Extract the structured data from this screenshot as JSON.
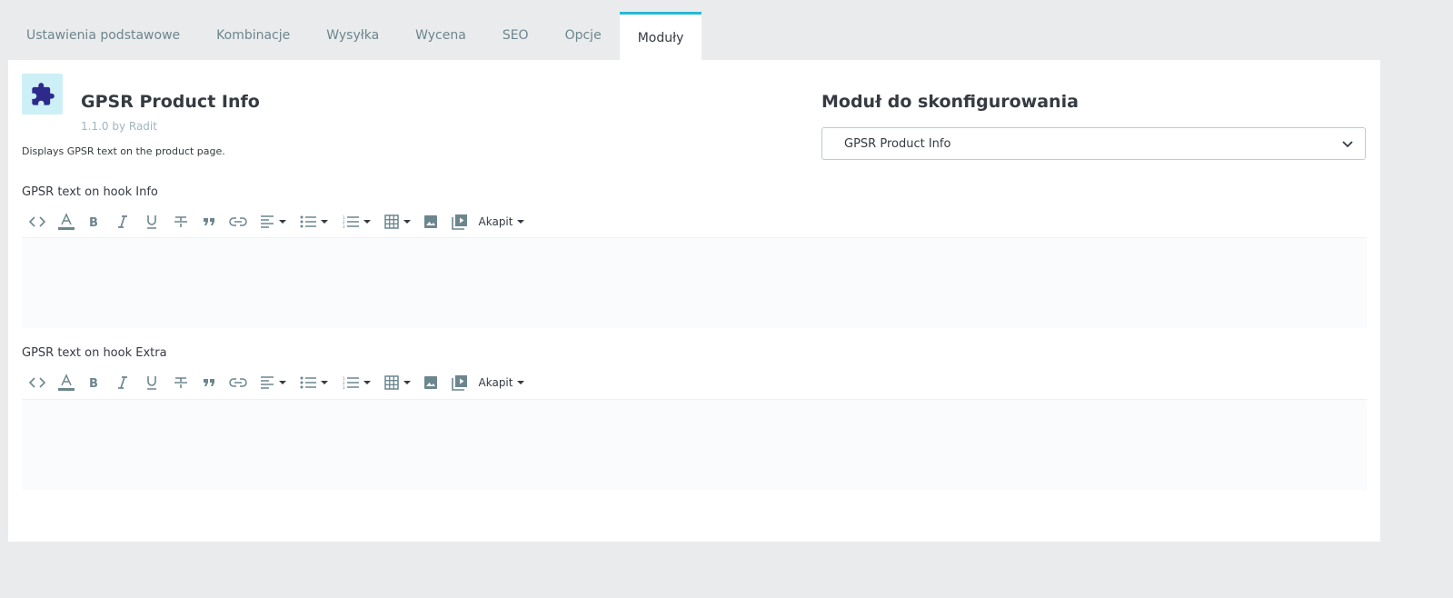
{
  "tabs": [
    {
      "label": "Ustawienia podstawowe",
      "active": false
    },
    {
      "label": "Kombinacje",
      "active": false
    },
    {
      "label": "Wysyłka",
      "active": false
    },
    {
      "label": "Wycena",
      "active": false
    },
    {
      "label": "SEO",
      "active": false
    },
    {
      "label": "Opcje",
      "active": false
    },
    {
      "label": "Moduły",
      "active": true
    }
  ],
  "module": {
    "icon": "puzzle-icon",
    "title": "GPSR Product Info",
    "version": "1.1.0 by Radit",
    "description": "Displays GPSR text on the product page."
  },
  "config": {
    "title": "Moduł do skonfigurowania",
    "selected": "GPSR Product Info"
  },
  "fields": [
    {
      "label": "GPSR text on hook Info",
      "value": ""
    },
    {
      "label": "GPSR text on hook Extra",
      "value": ""
    }
  ],
  "toolbar": {
    "paragraph_label": "Akapit",
    "icons": [
      "code-icon",
      "text-color-icon",
      "bold-icon",
      "italic-icon",
      "underline-icon",
      "strikethrough-icon",
      "blockquote-icon",
      "link-icon",
      "align-icon",
      "bullet-list-icon",
      "numbered-list-icon",
      "table-icon",
      "image-icon",
      "media-icon"
    ]
  },
  "colors": {
    "accent": "#25b9d7",
    "icon_bg": "#cdeff6",
    "icon_fg": "#2d2a8c",
    "muted": "#6c868e",
    "background": "#eaebec"
  }
}
